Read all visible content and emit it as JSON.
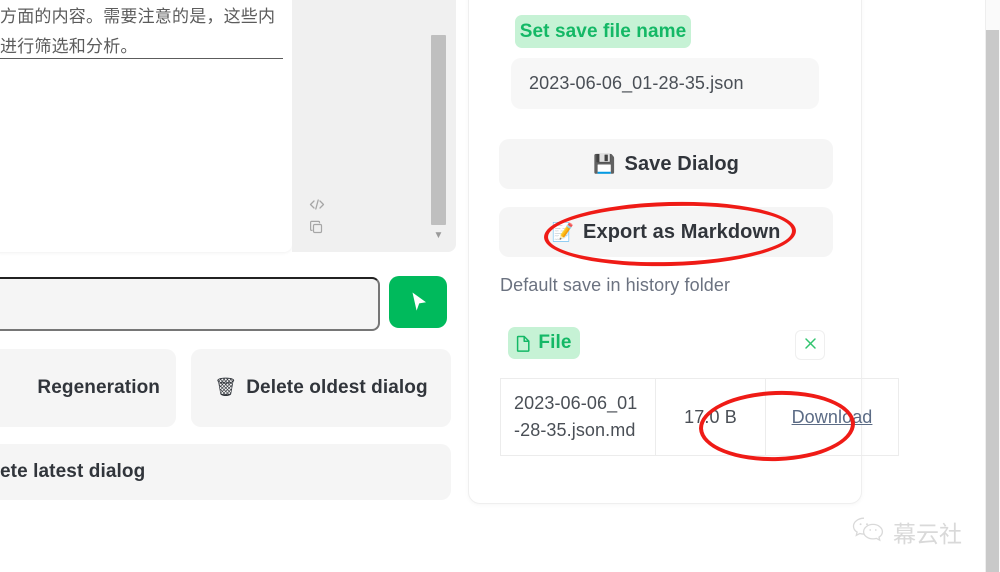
{
  "left_panel": {
    "chat_output_text": "方面的内容。需要注意的是，这些内\n进行筛选和分析。",
    "code_icon": "code-icon",
    "copy_icon": "copy-icon",
    "message_input_value": "",
    "send_button_icon": "cursor-arrow-icon",
    "buttons": [
      {
        "label": "Regeneration",
        "icon": ""
      },
      {
        "label": "Delete oldest dialog",
        "icon": "🗑"
      },
      {
        "label": "ete latest dialog",
        "icon": ""
      }
    ]
  },
  "right_panel": {
    "filename_label": "Set save file name",
    "filename_value": "2023-06-06_01-28-35.json",
    "save_dialog_label": "Save Dialog",
    "save_dialog_icon": "💾",
    "export_markdown_label": "Export as Markdown",
    "export_markdown_icon": "📝",
    "hint": "Default save in history folder",
    "file_badge_label": "File",
    "close_label": "✕",
    "file_table": {
      "rows": [
        {
          "name": "2023-06-06_01-28-35.json.md",
          "size": "17.0 B",
          "action": "Download"
        }
      ]
    }
  },
  "annotations": {
    "export_ellipse": "red-ellipse-export",
    "download_ellipse": "red-ellipse-download",
    "color": "#ef1b16"
  },
  "watermark": {
    "text": "幕云社",
    "icon": "wechat-icon"
  },
  "colors": {
    "accent_green": "#00ba5c",
    "badge_green_bg": "#c6f2d5",
    "badge_green_text": "#14b866",
    "button_gray": "#f5f5f5",
    "annotation_red": "#ef1b16"
  }
}
